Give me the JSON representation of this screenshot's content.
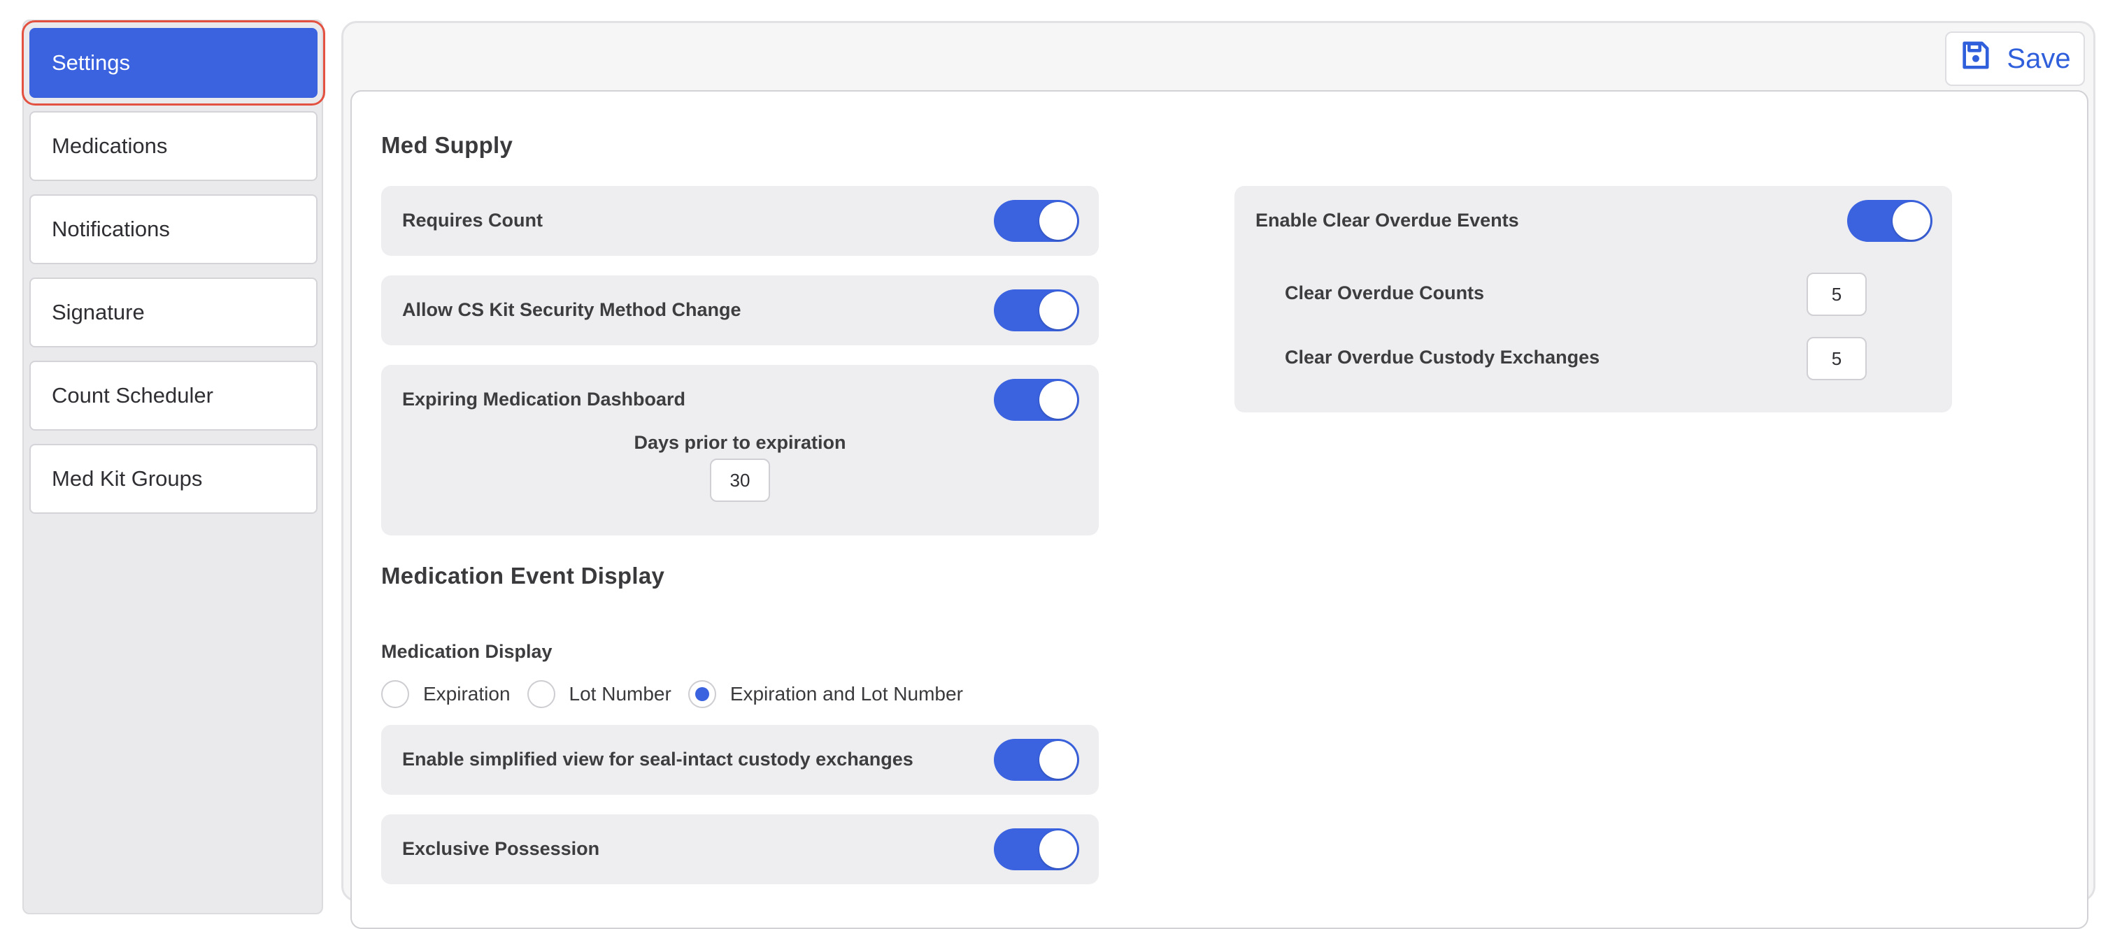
{
  "sidebar": {
    "items": [
      {
        "label": "Settings",
        "active": true
      },
      {
        "label": "Medications"
      },
      {
        "label": "Notifications"
      },
      {
        "label": "Signature"
      },
      {
        "label": "Count Scheduler"
      },
      {
        "label": "Med Kit Groups"
      }
    ]
  },
  "toolbar": {
    "save_label": "Save",
    "save_icon": "floppy-disk-icon"
  },
  "med_supply": {
    "title": "Med Supply",
    "requires_count": {
      "label": "Requires Count",
      "enabled": true
    },
    "allow_cs_kit": {
      "label": "Allow CS Kit Security Method Change",
      "enabled": true
    },
    "expiring_dashboard": {
      "label": "Expiring Medication Dashboard",
      "enabled": true,
      "days_label": "Days prior to expiration",
      "days_value": "30"
    },
    "clear_overdue": {
      "label": "Enable Clear Overdue Events",
      "enabled": true,
      "counts_label": "Clear Overdue Counts",
      "counts_value": "5",
      "custody_label": "Clear Overdue Custody Exchanges",
      "custody_value": "5"
    }
  },
  "event_display": {
    "title": "Medication Event Display",
    "display_label": "Medication Display",
    "options": [
      {
        "label": "Expiration",
        "checked": false
      },
      {
        "label": "Lot Number",
        "checked": false
      },
      {
        "label": "Expiration and Lot Number",
        "checked": true
      }
    ],
    "simplified_view": {
      "label": "Enable simplified view for seal-intact custody exchanges",
      "enabled": true
    },
    "exclusive_possession": {
      "label": "Exclusive Possession",
      "enabled": true
    }
  },
  "colors": {
    "accent": "#3b63e0",
    "active_outline": "#e35140"
  }
}
